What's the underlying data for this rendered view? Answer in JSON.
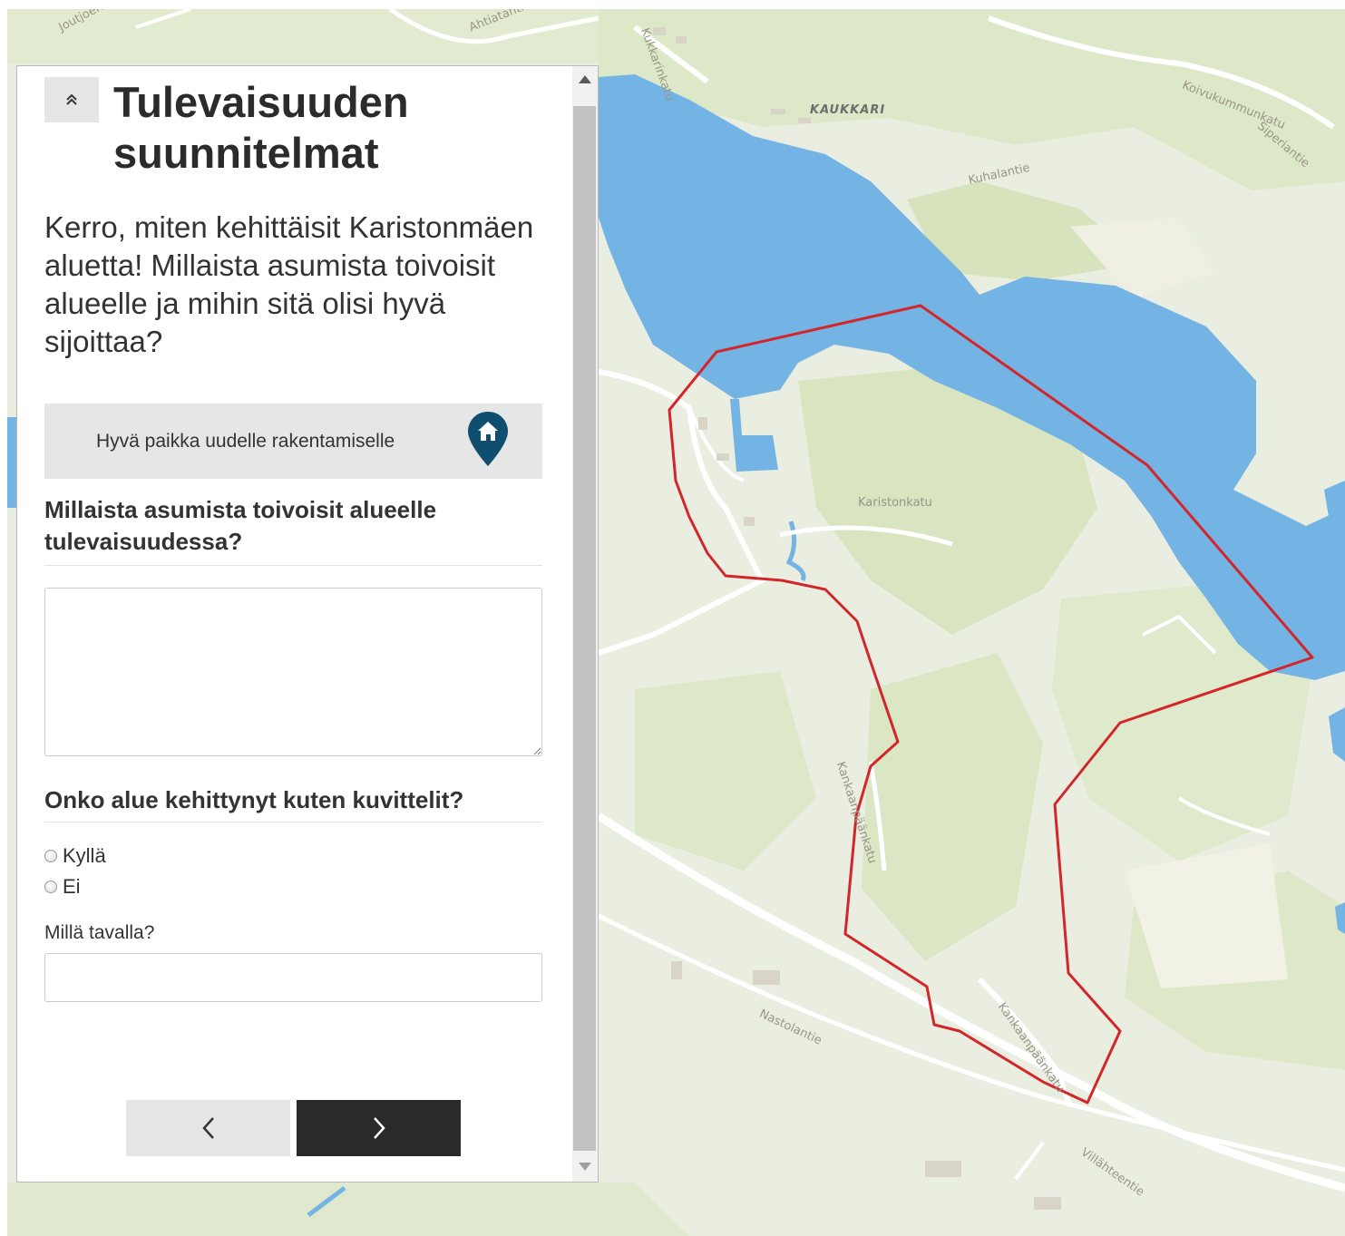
{
  "map": {
    "street_labels": [
      "Joutjoentie",
      "Ahtiatantie",
      "Kukkarinkatu",
      "Koivukummunkatu",
      "Siperiantie",
      "Kuhalantie",
      "Karistonkatu",
      "Kankaanpäänkatu",
      "Kankaanpäänkatu",
      "Nastolantie",
      "Villähteentie"
    ],
    "district_label": "KAUKKARI",
    "colors": {
      "land": "#eaeee0",
      "water": "#73b4e4",
      "area_outline": "#d2262b",
      "forest": "#dce7c6",
      "roads": "#ffffff"
    }
  },
  "panel": {
    "title": "Tulevaisuuden suunnitelmat",
    "intro": "Kerro, miten kehittäisit Karistonmäen aluetta! Millaista asumista toivoisit alueelle ja mihin sitä olisi hyvä sijoittaa?",
    "place_button_label": "Hyvä paikka uudelle rakentamiselle",
    "place_icon": "home-map-pin-icon",
    "question1": "Millaista asumista toivoisit alueelle tulevaisuudessa?",
    "question2": "Onko alue kehittynyt kuten kuvittelit?",
    "options": [
      "Kyllä",
      "Ei"
    ],
    "how_label": "Millä tavalla?",
    "prev_icon": "chevron-left-icon",
    "next_icon": "chevron-right-icon",
    "collapse_icon": "double-chevron-up-icon",
    "colors": {
      "pin": "#0f4e6e",
      "next_button": "#2a2a2a",
      "secondary_button": "#e6e6e6"
    }
  }
}
